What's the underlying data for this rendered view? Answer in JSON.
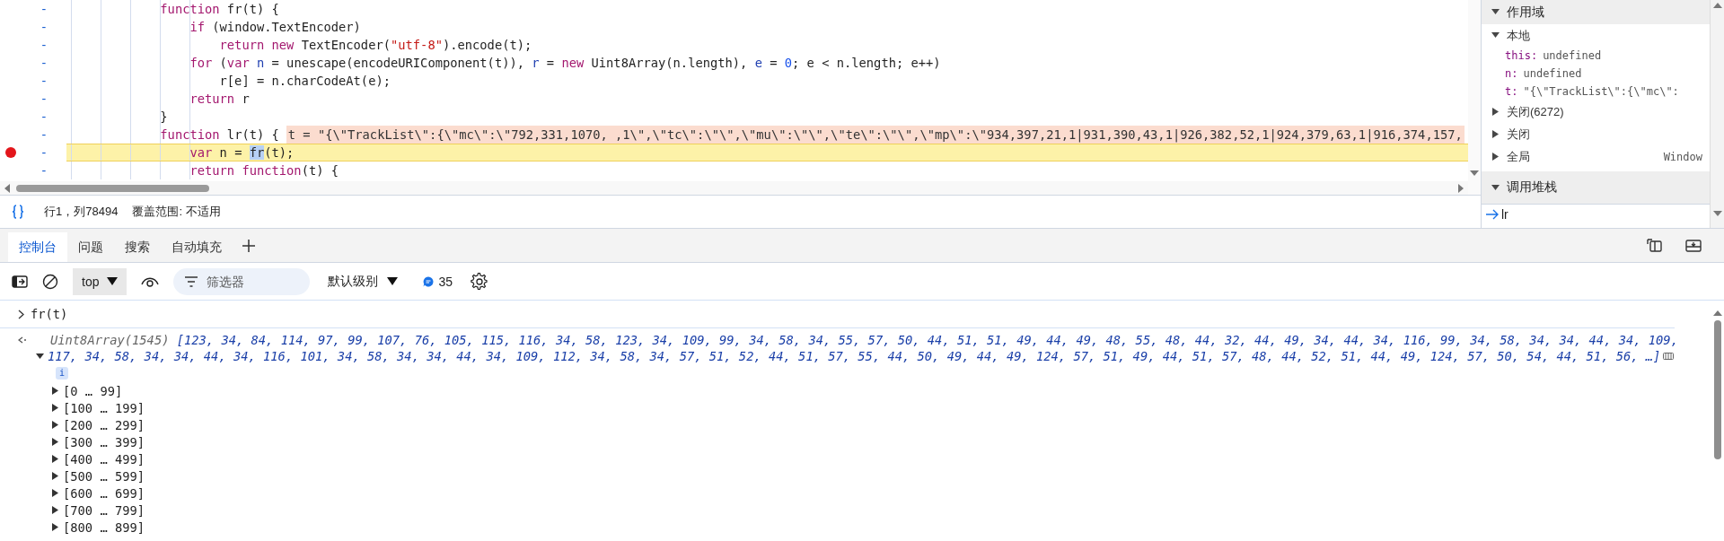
{
  "editor": {
    "lines": [
      {
        "gutter": "-",
        "breakpoint": false,
        "paused": false,
        "tokens": [
          {
            "kind": "keyword",
            "text": "            function"
          },
          {
            "kind": "plain",
            "text": " fr(t) {"
          }
        ]
      },
      {
        "gutter": "-",
        "breakpoint": false,
        "paused": false,
        "tokens": [
          {
            "kind": "keyword",
            "text": "                if"
          },
          {
            "kind": "plain",
            "text": " (window.TextEncoder)"
          }
        ]
      },
      {
        "gutter": "-",
        "breakpoint": false,
        "paused": false,
        "tokens": [
          {
            "kind": "keyword",
            "text": "                    return new"
          },
          {
            "kind": "plain",
            "text": " TextEncoder("
          },
          {
            "kind": "string",
            "text": "\"utf-8\""
          },
          {
            "kind": "plain",
            "text": ").encode(t);"
          }
        ]
      },
      {
        "gutter": "-",
        "breakpoint": false,
        "paused": false,
        "tokens": [
          {
            "kind": "keyword",
            "text": "                for"
          },
          {
            "kind": "plain",
            "text": " ("
          },
          {
            "kind": "keyword",
            "text": "var"
          },
          {
            "kind": "variable",
            "text": " n"
          },
          {
            "kind": "plain",
            "text": " = unescape(encodeURIComponent(t)), "
          },
          {
            "kind": "variable",
            "text": "r"
          },
          {
            "kind": "plain",
            "text": " = "
          },
          {
            "kind": "keyword",
            "text": "new"
          },
          {
            "kind": "plain",
            "text": " Uint8Array(n.length), "
          },
          {
            "kind": "variable",
            "text": "e"
          },
          {
            "kind": "plain",
            "text": " = "
          },
          {
            "kind": "number",
            "text": "0"
          },
          {
            "kind": "plain",
            "text": "; e < n.length; e++)"
          }
        ]
      },
      {
        "gutter": "-",
        "breakpoint": false,
        "paused": false,
        "tokens": [
          {
            "kind": "plain",
            "text": "                    r[e] = n.charCodeAt(e);"
          }
        ]
      },
      {
        "gutter": "-",
        "breakpoint": false,
        "paused": false,
        "tokens": [
          {
            "kind": "keyword",
            "text": "                return"
          },
          {
            "kind": "plain",
            "text": " r"
          }
        ]
      },
      {
        "gutter": "-",
        "breakpoint": false,
        "paused": false,
        "tokens": [
          {
            "kind": "plain",
            "text": "            }"
          }
        ]
      },
      {
        "gutter": "-",
        "breakpoint": false,
        "paused": false,
        "tokens": [
          {
            "kind": "keyword",
            "text": "            function"
          },
          {
            "kind": "plain",
            "text": " lr(t) {"
          }
        ],
        "inline_value": "t = \"{\\\"TrackList\\\":{\\\"mc\\\":\\\"792,331,1070, ,1\\\",\\\"tc\\\":\\\"\\\",\\\"mu\\\":\\\"\\\",\\\"te\\\":\\\"\\\",\\\"mp\\\":\\\"934,397,21,1|931,390,43,1|926,382,52,1|924,379,63,1|916,374,157,"
      },
      {
        "gutter": "-",
        "breakpoint": true,
        "paused": true,
        "tokens": [
          {
            "kind": "keyword",
            "text": "                var"
          },
          {
            "kind": "plain",
            "text": " n = "
          },
          {
            "kind": "selection",
            "text": "fr"
          },
          {
            "kind": "plain",
            "text": "(t);"
          }
        ]
      },
      {
        "gutter": "-",
        "breakpoint": false,
        "paused": false,
        "tokens": [
          {
            "kind": "keyword",
            "text": "                return function"
          },
          {
            "kind": "plain",
            "text": "(t) {"
          }
        ]
      }
    ],
    "status": {
      "position": "行1，列78494",
      "coverage": "覆盖范围: 不适用"
    }
  },
  "scope": {
    "title": "作用域",
    "expanded": true,
    "groups": [
      {
        "label": "本地",
        "expanded": true,
        "variables": [
          {
            "name": "this:",
            "value": "undefined"
          },
          {
            "name": "n:",
            "value": "undefined"
          },
          {
            "name": "t:",
            "value": "\"{\\\"TrackList\\\":{\\\"mc\\\":"
          }
        ]
      },
      {
        "label": "关闭(6272)",
        "expanded": false
      },
      {
        "label": "关闭",
        "expanded": false
      },
      {
        "label": "全局",
        "expanded": false,
        "value": "Window"
      }
    ]
  },
  "call_stack": {
    "title": "调用堆栈",
    "expanded": true,
    "frames": [
      {
        "name": "lr",
        "current": true
      }
    ]
  },
  "drawer": {
    "tabs": [
      {
        "label": "控制台",
        "selected": true
      },
      {
        "label": "问题",
        "selected": false
      },
      {
        "label": "搜索",
        "selected": false
      },
      {
        "label": "自动填充",
        "selected": false
      }
    ]
  },
  "console_toolbar": {
    "context": "top",
    "filter": {
      "placeholder": "筛选器"
    },
    "level": "默认级别",
    "message_count": "35"
  },
  "console": {
    "entries": [
      {
        "kind": "input",
        "text": "fr(t)"
      },
      {
        "kind": "result",
        "summary": "Uint8Array(1545)",
        "preview": [
          "[123, 34, 84, 114, 97, 99, 107, 76, 105, 115, 116, 34, 58, 123, 34, 109, 99, 34, 58, 34, 55, 57, 50, 44, 51, 51, 49, 44, 49, 48, 55, 48, 44, 32, 44, 49, 34, 44, 34, 116, 99, 34, 58, 34, 34, 44, 34, 109,",
          "117, 34, 58, 34, 34, 44, 34, 116, 101, 34, 58, 34, 34, 44, 34, 109, 112, 34, 58, 34, 57, 51, 52, 44, 51, 57, 55, 44, 50, 49, 44, 49, 124, 57, 51, 49, 44, 51, 57, 48, 44, 52, 51, 44, 49, 124, 57, 50, 54, 44, 51, 56, …]"
        ],
        "expanded": true,
        "badge": "i",
        "groups": [
          {
            "label": "[0 … 99]",
            "expanded": false
          },
          {
            "label": "[100 … 199]",
            "expanded": false
          },
          {
            "label": "[200 … 299]",
            "expanded": false
          },
          {
            "label": "[300 … 399]",
            "expanded": false
          },
          {
            "label": "[400 … 499]",
            "expanded": false
          },
          {
            "label": "[500 … 599]",
            "expanded": false
          },
          {
            "label": "[600 … 699]",
            "expanded": false
          },
          {
            "label": "[700 … 799]",
            "expanded": false
          },
          {
            "label": "[800 … 899]",
            "expanded": false
          }
        ]
      }
    ]
  }
}
